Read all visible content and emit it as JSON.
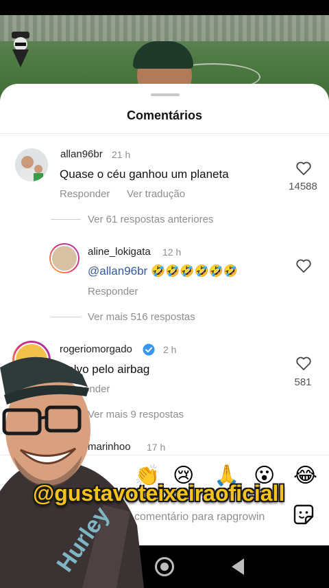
{
  "sheet": {
    "title": "Comentários"
  },
  "comments": [
    {
      "username": "allan96br",
      "time": "21 h",
      "text": "Quase o céu ganhou um planeta",
      "reply_label": "Responder",
      "translate_label": "Ver tradução",
      "likes": "14588"
    }
  ],
  "view_previous": "Ver 61 respostas anteriores",
  "reply": {
    "username": "aline_lokigata",
    "time": "12 h",
    "mention": "@allan96br",
    "emojis": "🤣🤣🤣🤣🤣🤣",
    "reply_label": "Responder"
  },
  "view_more_1": "Ver mais 516 respostas",
  "comment2": {
    "username": "rogeriomorgado",
    "time": "2 h",
    "text": "Salvo pelo airbag",
    "reply_label": "Responder",
    "likes": "581"
  },
  "view_more_2": "Ver mais 9 respostas",
  "comment3": {
    "username": "marinhoo",
    "time": "17 h"
  },
  "reactions": [
    "👏",
    "😢",
    "🙏",
    "😮",
    "😂"
  ],
  "composer": {
    "placeholder": "comentário para rapgrowin"
  },
  "overlay": {
    "handle": "@gustavoteixeiraoficiall"
  },
  "colors": {
    "mention": "#365899",
    "handle_text": "#f5c21b",
    "verified": "#3897f0"
  }
}
